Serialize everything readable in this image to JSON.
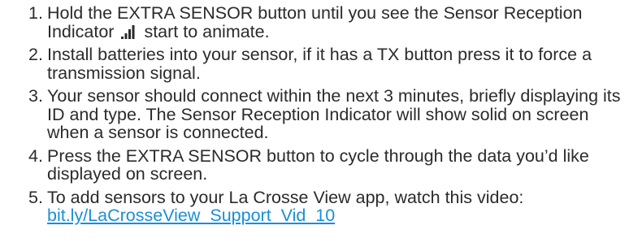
{
  "steps": [
    {
      "number": "1.",
      "text_before_icon": "Hold the EXTRA SENSOR button until you see the Sensor Reception Indicator",
      "icon": "signal-strength-icon",
      "text_after_icon": "start to animate."
    },
    {
      "number": "2.",
      "text": "Install batteries into your sensor, if it has a TX button press it to force a transmission signal."
    },
    {
      "number": "3.",
      "text": "Your sensor should connect within the next 3 minutes, briefly displaying its ID and type. The Sensor Reception Indicator will show solid on screen when a sensor is connected."
    },
    {
      "number": "4.",
      "text": "Press the EXTRA SENSOR button to cycle through the data you’d like displayed on screen."
    },
    {
      "number": "5.",
      "text": "To add sensors to your La Crosse View app, watch this video:",
      "link_text": "bit.ly/LaCrosseView_Support_Vid_10"
    }
  ],
  "colors": {
    "text": "#2b2b2b",
    "link": "#1a8fd6"
  }
}
